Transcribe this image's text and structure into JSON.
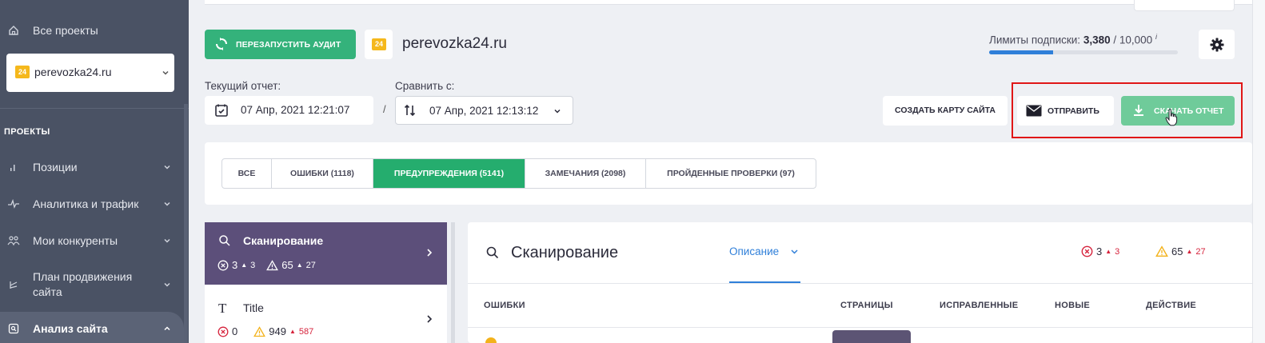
{
  "sidebar": {
    "all_projects": "Все проекты",
    "project_name": "perevozka24.ru",
    "section_title": "ПРОЕКТЫ",
    "items": [
      {
        "label": "Позиции",
        "icon": "bar-chart-icon"
      },
      {
        "label": "Аналитика и трафик",
        "icon": "pulse-icon"
      },
      {
        "label": "Мои конкуренты",
        "icon": "users-icon"
      },
      {
        "label": "План продвижения сайта",
        "icon": "plan-icon"
      },
      {
        "label": "Анализ сайта",
        "icon": "site-audit-icon"
      }
    ]
  },
  "header": {
    "restart_label": "ПЕРЕЗАПУСТИТЬ АУДИТ",
    "site_name": "perevozka24.ru",
    "limits_label": "Лимиты подписки:",
    "limits_used": "3,380",
    "limits_total": "/ 10,000",
    "limits_info": "i",
    "limits_fraction": 0.338
  },
  "report": {
    "current_label": "Текущий отчет:",
    "current_date": "07 Апр, 2021 12:21:07",
    "separator": "/",
    "compare_label": "Сравнить с:",
    "compare_date": "07 Апр, 2021 12:13:12"
  },
  "actions": {
    "sitemap_label": "СОЗДАТЬ КАРТУ САЙТА",
    "send_label": "ОТПРАВИТЬ",
    "download_label": "СКАЧАТЬ ОТЧЕТ"
  },
  "tabs": [
    {
      "label": "ВСЕ",
      "active": false
    },
    {
      "label": "ОШИБКИ (1118)",
      "active": false
    },
    {
      "label": "ПРЕДУПРЕЖДЕНИЯ (5141)",
      "active": true
    },
    {
      "label": "ЗАМЕЧАНИЯ (2098)",
      "active": false
    },
    {
      "label": "ПРОЙДЕННЫЕ ПРОВЕРКИ (97)",
      "active": false
    }
  ],
  "checks": [
    {
      "title": "Сканирование",
      "errors": "3",
      "errors_new": "3",
      "warnings": "65",
      "warnings_new": "27"
    },
    {
      "title": "Title",
      "errors": "0",
      "warnings": "949",
      "warnings_new": "587"
    }
  ],
  "panel": {
    "title": "Сканирование",
    "description_tab": "Описание",
    "errors": "3",
    "errors_new": "3",
    "warnings": "65",
    "warnings_new": "27",
    "columns": [
      "ОШИБКИ",
      "СТРАНИЦЫ",
      "ИСПРАВЛЕННЫЕ",
      "НОВЫЕ",
      "ДЕЙСТВИЕ"
    ]
  },
  "colors": {
    "sidebar_bg": "#4a5264",
    "accent_green": "#25ad6e",
    "download_green": "#6fcb9a",
    "active_check": "#5c4f7a",
    "link_blue": "#2f7fd9",
    "error_red": "#d6233c",
    "warning_yellow": "#f3b21b",
    "highlight_red": "#e01717"
  }
}
